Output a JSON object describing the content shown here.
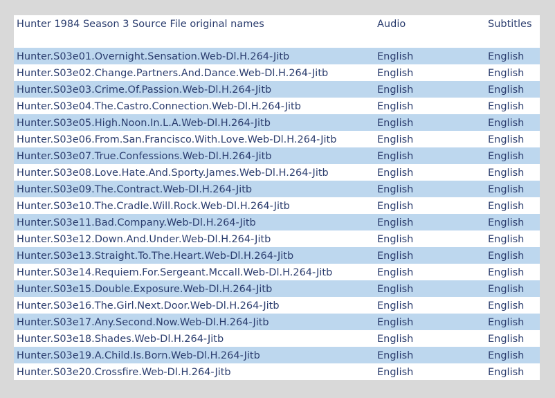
{
  "header": {
    "name": "Hunter 1984 Season 3 Source File original names",
    "audio": "Audio",
    "subtitles": "Subtitles"
  },
  "rows": [
    {
      "name": "Hunter.S03e01.Overnight.Sensation.Web-Dl.H.264-Jitb",
      "audio": "English",
      "subtitles": "English"
    },
    {
      "name": "Hunter.S03e02.Change.Partners.And.Dance.Web-Dl.H.264-Jitb",
      "audio": "English",
      "subtitles": "English"
    },
    {
      "name": "Hunter.S03e03.Crime.Of.Passion.Web-Dl.H.264-Jitb",
      "audio": "English",
      "subtitles": "English"
    },
    {
      "name": "Hunter.S03e04.The.Castro.Connection.Web-Dl.H.264-Jitb",
      "audio": "English",
      "subtitles": "English"
    },
    {
      "name": "Hunter.S03e05.High.Noon.In.L.A.Web-Dl.H.264-Jitb",
      "audio": "English",
      "subtitles": "English"
    },
    {
      "name": "Hunter.S03e06.From.San.Francisco.With.Love.Web-Dl.H.264-Jitb",
      "audio": "English",
      "subtitles": "English"
    },
    {
      "name": "Hunter.S03e07.True.Confessions.Web-Dl.H.264-Jitb",
      "audio": "English",
      "subtitles": "English"
    },
    {
      "name": "Hunter.S03e08.Love.Hate.And.Sporty.James.Web-Dl.H.264-Jitb",
      "audio": "English",
      "subtitles": "English"
    },
    {
      "name": "Hunter.S03e09.The.Contract.Web-Dl.H.264-Jitb",
      "audio": "English",
      "subtitles": "English"
    },
    {
      "name": "Hunter.S03e10.The.Cradle.Will.Rock.Web-Dl.H.264-Jitb",
      "audio": "English",
      "subtitles": "English"
    },
    {
      "name": "Hunter.S03e11.Bad.Company.Web-Dl.H.264-Jitb",
      "audio": "English",
      "subtitles": "English"
    },
    {
      "name": "Hunter.S03e12.Down.And.Under.Web-Dl.H.264-Jitb",
      "audio": "English",
      "subtitles": "English"
    },
    {
      "name": "Hunter.S03e13.Straight.To.The.Heart.Web-Dl.H.264-Jitb",
      "audio": "English",
      "subtitles": "English"
    },
    {
      "name": "Hunter.S03e14.Requiem.For.Sergeant.Mccall.Web-Dl.H.264-Jitb",
      "audio": "English",
      "subtitles": "English"
    },
    {
      "name": "Hunter.S03e15.Double.Exposure.Web-Dl.H.264-Jitb",
      "audio": "English",
      "subtitles": "English"
    },
    {
      "name": "Hunter.S03e16.The.Girl.Next.Door.Web-Dl.H.264-Jitb",
      "audio": "English",
      "subtitles": "English"
    },
    {
      "name": "Hunter.S03e17.Any.Second.Now.Web-Dl.H.264-Jitb",
      "audio": "English",
      "subtitles": "English"
    },
    {
      "name": "Hunter.S03e18.Shades.Web-Dl.H.264-Jitb",
      "audio": "English",
      "subtitles": "English"
    },
    {
      "name": "Hunter.S03e19.A.Child.Is.Born.Web-Dl.H.264-Jitb",
      "audio": "English",
      "subtitles": "English"
    },
    {
      "name": "Hunter.S03e20.Crossfire.Web-Dl.H.264-Jitb",
      "audio": "English",
      "subtitles": "English"
    }
  ],
  "colors": {
    "band": "#bdd7ee",
    "text": "#2b3d6e",
    "background": "#d9d9d9"
  }
}
